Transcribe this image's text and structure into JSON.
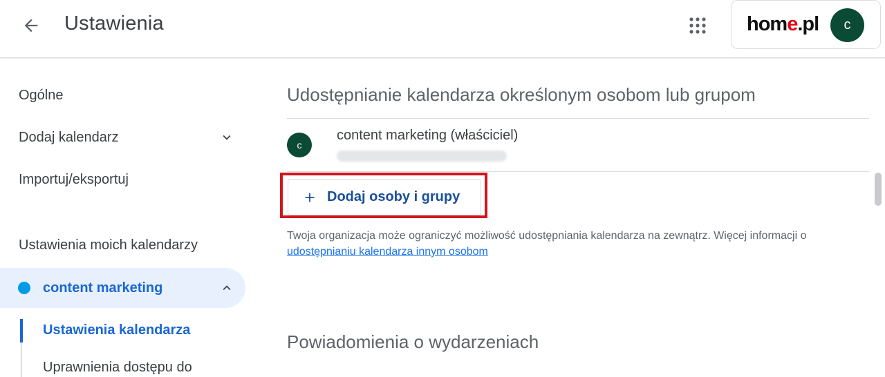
{
  "header": {
    "title": "Ustawienia",
    "brand_prefix": "hom",
    "brand_accent": "e",
    "brand_suffix": ".pl",
    "avatar_letter": "c",
    "colors": {
      "avatar_bg": "#0b4a34",
      "brand_accent": "#e30613"
    }
  },
  "sidebar": {
    "items": [
      {
        "label": "Ogólne"
      },
      {
        "label": "Dodaj kalendarz"
      },
      {
        "label": "Importuj/eksportuj"
      }
    ],
    "section_label": "Ustawienia moich kalendarzy",
    "calendar": {
      "label": "content marketing",
      "color": "#039be5"
    },
    "sub_items": [
      {
        "label": "Ustawienia kalendarza"
      },
      {
        "label": "Uprawnienia dostępu do"
      }
    ]
  },
  "main": {
    "sharing_title": "Udostępnianie kalendarza określonym osobom lub grupom",
    "owner": {
      "avatar_letter": "c",
      "name": "content marketing (właściciel)"
    },
    "add_button_label": "Dodaj osoby i grupy",
    "info_text": "Twoja organizacja może ograniczyć możliwość udostępniania kalendarza na zewnątrz. Więcej informacji o ",
    "info_link": "udostępnianiu kalendarza innym osobom",
    "notifications_title": "Powiadomienia o wydarzeniach"
  },
  "icons": {
    "back": "arrow-back-icon",
    "apps": "apps-grid-icon",
    "chevron_down": "chevron-down-icon",
    "chevron_up": "chevron-up-icon",
    "plus": "plus-icon"
  }
}
